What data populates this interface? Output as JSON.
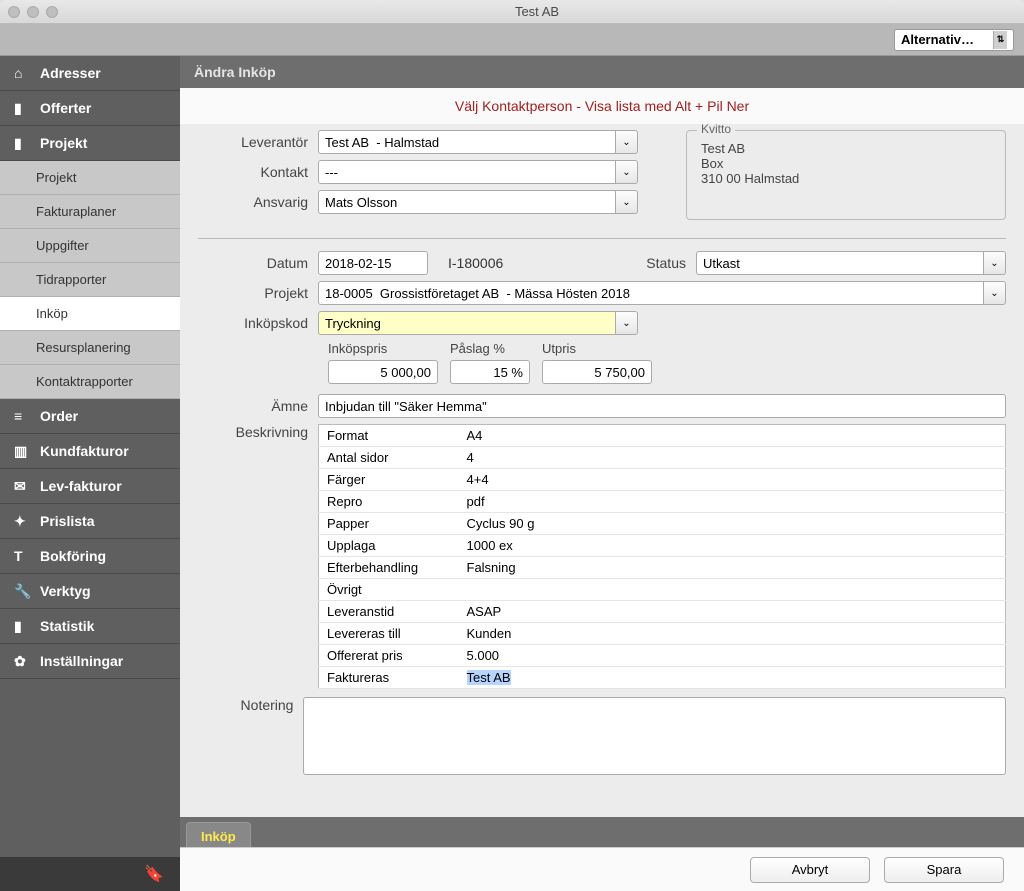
{
  "window_title": "Test AB",
  "toolbar": {
    "alternative_label": "Alternativ…"
  },
  "sidebar": {
    "items": [
      {
        "label": "Adresser",
        "icon": "home-icon"
      },
      {
        "label": "Offerter",
        "icon": "doc-icon"
      },
      {
        "label": "Projekt",
        "icon": "doc-icon",
        "expanded": true,
        "sub": [
          {
            "label": "Projekt"
          },
          {
            "label": "Fakturaplaner"
          },
          {
            "label": "Uppgifter"
          },
          {
            "label": "Tidrapporter"
          },
          {
            "label": "Inköp",
            "active": true
          },
          {
            "label": "Resursplanering"
          },
          {
            "label": "Kontaktrapporter"
          }
        ]
      },
      {
        "label": "Order",
        "icon": "list-icon"
      },
      {
        "label": "Kundfakturor",
        "icon": "invoice-icon"
      },
      {
        "label": "Lev-fakturor",
        "icon": "mail-icon"
      },
      {
        "label": "Prislista",
        "icon": "tag-icon"
      },
      {
        "label": "Bokföring",
        "icon": "t-icon"
      },
      {
        "label": "Verktyg",
        "icon": "wrench-icon"
      },
      {
        "label": "Statistik",
        "icon": "stats-icon"
      },
      {
        "label": "Inställningar",
        "icon": "gear-icon"
      }
    ]
  },
  "header": {
    "title": "Ändra Inköp"
  },
  "hint": "Välj Kontaktperson - Visa lista med Alt + Pil Ner",
  "form": {
    "leverantor_label": "Leverantör",
    "leverantor_value": "Test AB  - Halmstad",
    "kontakt_label": "Kontakt",
    "kontakt_value": "---",
    "ansvarig_label": "Ansvarig",
    "ansvarig_value": "Mats Olsson",
    "kvitto_legend": "Kvitto",
    "kvitto_lines": [
      "Test AB",
      "Box",
      "310 00  Halmstad"
    ],
    "datum_label": "Datum",
    "datum_value": "2018-02-15",
    "inumber": "I-180006",
    "status_label": "Status",
    "status_value": "Utkast",
    "projekt_label": "Projekt",
    "projekt_value": "18-0005  Grossistföretaget AB  - Mässa Hösten 2018",
    "inkopskod_label": "Inköpskod",
    "inkopskod_value": "Tryckning",
    "inkopspris_label": "Inköpspris",
    "inkopspris_value": "5 000,00",
    "paslag_label": "Påslag %",
    "paslag_value": "15 %",
    "utpris_label": "Utpris",
    "utpris_value": "5 750,00",
    "amne_label": "Ämne",
    "amne_value": "Inbjudan till \"Säker Hemma\"",
    "beskrivning_label": "Beskrivning",
    "desc_rows": [
      [
        "Format",
        "A4"
      ],
      [
        "Antal sidor",
        "4"
      ],
      [
        "Färger",
        "4+4"
      ],
      [
        "Repro",
        "pdf"
      ],
      [
        "Papper",
        "Cyclus 90 g"
      ],
      [
        "Upplaga",
        "1000 ex"
      ],
      [
        "Efterbehandling",
        "Falsning"
      ],
      [
        "Övrigt",
        ""
      ],
      [
        "Leveranstid",
        "ASAP"
      ],
      [
        "Levereras till",
        "Kunden"
      ],
      [
        "Offererat pris",
        "5.000"
      ],
      [
        "Faktureras",
        "Test AB"
      ]
    ],
    "notering_label": "Notering"
  },
  "tabs": {
    "inkop": "Inköp"
  },
  "buttons": {
    "avbryt": "Avbryt",
    "spara": "Spara"
  }
}
